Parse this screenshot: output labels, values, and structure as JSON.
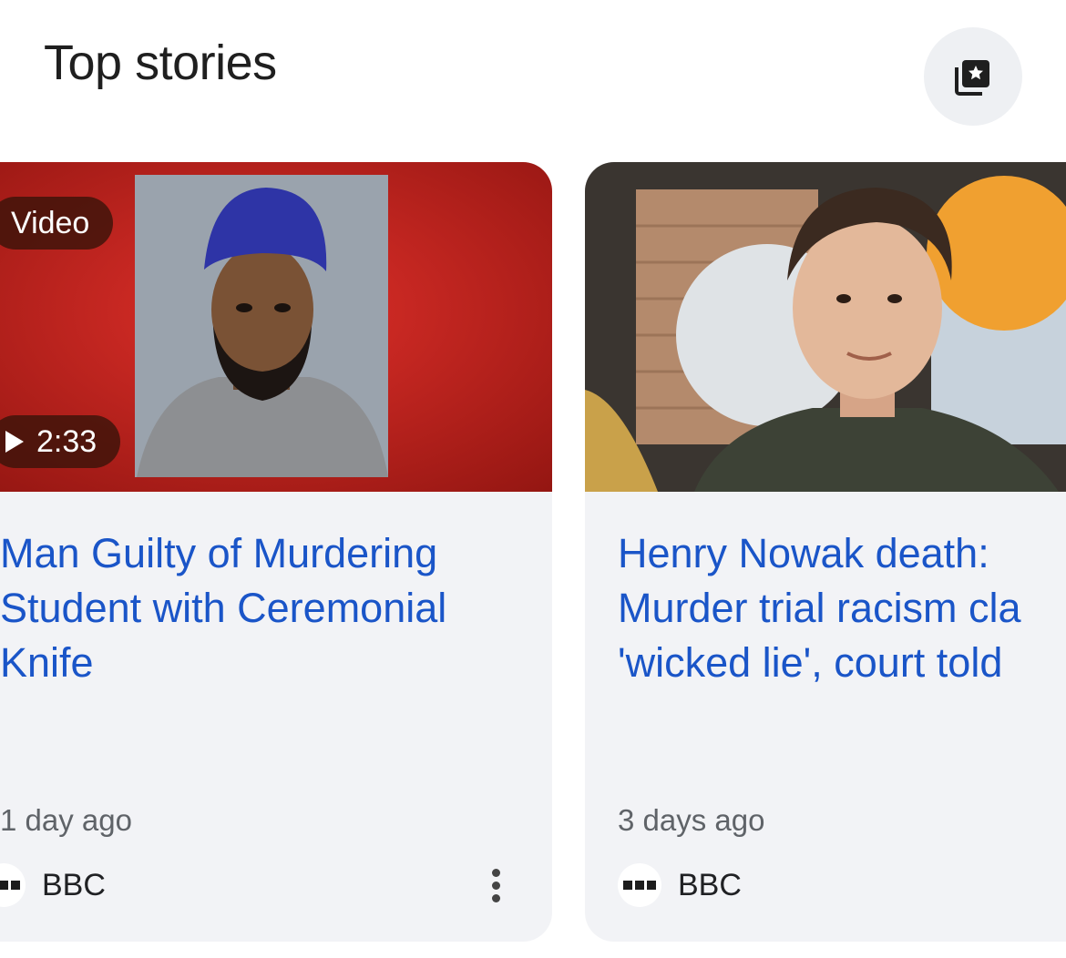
{
  "section": {
    "title": "Top stories",
    "save_icon": "bookmark-star-icon"
  },
  "stories": [
    {
      "badge": "Video",
      "duration": "2:33",
      "headline_lines": [
        "Man Guilty of Murdering",
        "Student with Ceremonial",
        "Knife"
      ],
      "time": "1 day ago",
      "source": "BBC",
      "thumbnail": "mugshot-photo",
      "accent_color": "#c8281f"
    },
    {
      "headline_lines": [
        "Henry Nowak death:",
        "Murder trial racism cla",
        "'wicked lie', court told"
      ],
      "time": "3 days ago",
      "source": "BBC",
      "thumbnail": "portrait-photo"
    }
  ],
  "colors": {
    "headline": "#1a55c8",
    "card_bg": "#f2f3f6",
    "meta_text": "#5f6368"
  }
}
